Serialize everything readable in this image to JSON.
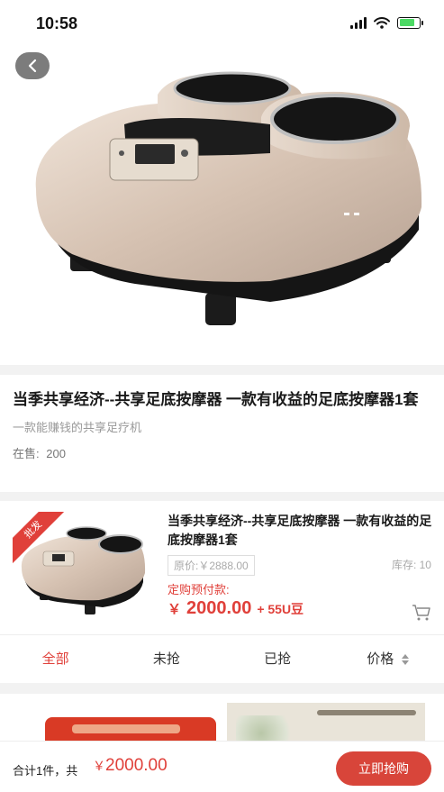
{
  "status_bar": {
    "time": "10:58"
  },
  "nav": {
    "back_icon": "chevron-left-icon"
  },
  "product": {
    "title": "当季共享经济--共享足底按摩器 一款有收益的足底按摩器1套",
    "subtitle": "一款能赚钱的共享足疗机",
    "on_sale_label": "在售:",
    "on_sale_count": "200"
  },
  "order": {
    "badge": "批发",
    "title": "当季共享经济--共享足底按摩器 一款有收益的足底按摩器1套",
    "original_price": "原价:￥2888.00",
    "stock": "库存: 10",
    "prepay_label": "定购预付款:",
    "prepay_currency": "￥",
    "prepay_amount": "2000.00",
    "beans": "+ 55U豆"
  },
  "tabs": [
    {
      "label": "全部"
    },
    {
      "label": "未抢"
    },
    {
      "label": "已抢"
    },
    {
      "label": "价格"
    }
  ],
  "bottom_bar": {
    "total_label": "合计1件，共",
    "total_currency": "￥",
    "total_amount": "2000.00",
    "buy_label": "立即抢购"
  },
  "colors": {
    "accent": "#e0403a",
    "buy_button": "#d8453a"
  }
}
